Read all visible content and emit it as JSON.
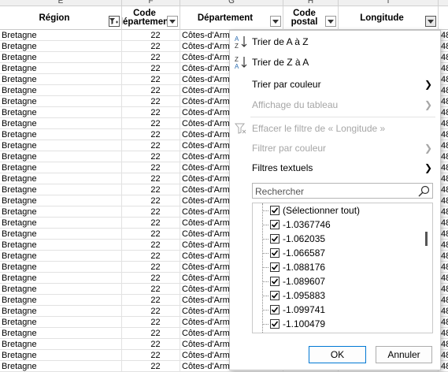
{
  "column_letters": [
    "E",
    "F",
    "G",
    "H",
    "I"
  ],
  "headers": {
    "region": "Région",
    "code_dept": "Code département",
    "departement": "Département",
    "code_postal": "Code postal",
    "longitude": "Longitude"
  },
  "rows": {
    "region": "Bretagne",
    "code": "22",
    "departement": "Côtes-d'Armor",
    "right_edge": "48"
  },
  "menu": {
    "sort_asc": "Trier de A à Z",
    "sort_desc": "Trier de Z à A",
    "sort_color": "Trier par couleur",
    "sheet_view": "Affichage du tableau",
    "clear_filter": "Effacer le filtre de « Longitude »",
    "filter_color": "Filtrer par couleur",
    "text_filters": "Filtres textuels",
    "search_placeholder": "Rechercher",
    "ok": "OK",
    "cancel": "Annuler"
  },
  "values": [
    "(Sélectionner tout)",
    "-1.0367746",
    "-1.062035",
    "-1.066587",
    "-1.088176",
    "-1.089607",
    "-1.095883",
    "-1.099741",
    "-1.100479"
  ],
  "icons": {
    "sort_asc": "sort-ascending-icon",
    "sort_desc": "sort-descending-icon",
    "clear": "clear-filter-icon",
    "search": "search-icon"
  },
  "colors": {
    "accent": "#0078d4",
    "sort_icon": "#2b6cb0"
  }
}
